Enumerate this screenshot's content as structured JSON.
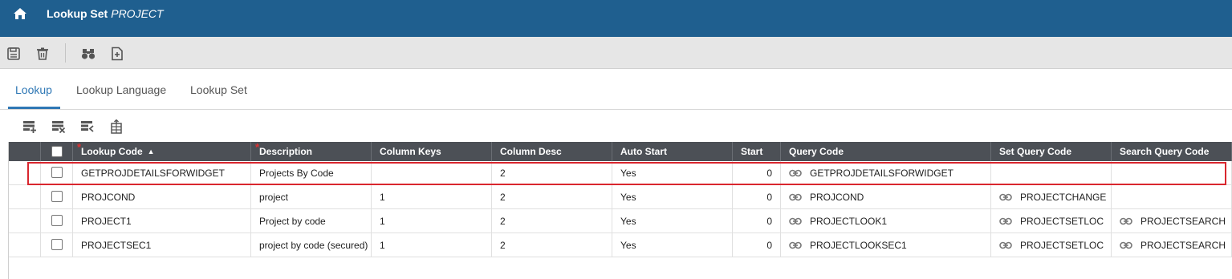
{
  "header": {
    "title": "Lookup Set",
    "entity": "PROJECT"
  },
  "tabs": [
    {
      "label": "Lookup",
      "active": true
    },
    {
      "label": "Lookup Language",
      "active": false
    },
    {
      "label": "Lookup Set",
      "active": false
    }
  ],
  "grid": {
    "columns": [
      "Lookup Code",
      "Description",
      "Column Keys",
      "Column Desc",
      "Auto Start",
      "Start",
      "Query Code",
      "Set Query Code",
      "Search Query Code"
    ],
    "required_columns": [
      "Lookup Code",
      "Description"
    ],
    "sort_indicator": "▲",
    "rows": [
      {
        "lookup_code": "GETPROJDETAILSFORWIDGET",
        "description": "Projects By Code",
        "column_keys": "",
        "column_desc": "2",
        "auto_start": "Yes",
        "start": "0",
        "query_code": "GETPROJDETAILSFORWIDGET",
        "set_query_code": "",
        "search_query_code": ""
      },
      {
        "lookup_code": "PROJCOND",
        "description": "project",
        "column_keys": "1",
        "column_desc": "2",
        "auto_start": "Yes",
        "start": "0",
        "query_code": "PROJCOND",
        "set_query_code": "PROJECTCHANGE",
        "search_query_code": ""
      },
      {
        "lookup_code": "PROJECT1",
        "description": "Project by code",
        "column_keys": "1",
        "column_desc": "2",
        "auto_start": "Yes",
        "start": "0",
        "query_code": "PROJECTLOOK1",
        "set_query_code": "PROJECTSETLOC",
        "search_query_code": "PROJECTSEARCH"
      },
      {
        "lookup_code": "PROJECTSEC1",
        "description": "project by code (secured)",
        "column_keys": "1",
        "column_desc": "2",
        "auto_start": "Yes",
        "start": "0",
        "query_code": "PROJECTLOOKSEC1",
        "set_query_code": "PROJECTSETLOC",
        "search_query_code": "PROJECTSEARCH"
      }
    ]
  },
  "colors": {
    "title_bar": "#1f5f8f",
    "tab_active": "#2f78b5",
    "header_bg": "#4c5056",
    "highlight": "#d9262e",
    "required": "#e03030"
  }
}
